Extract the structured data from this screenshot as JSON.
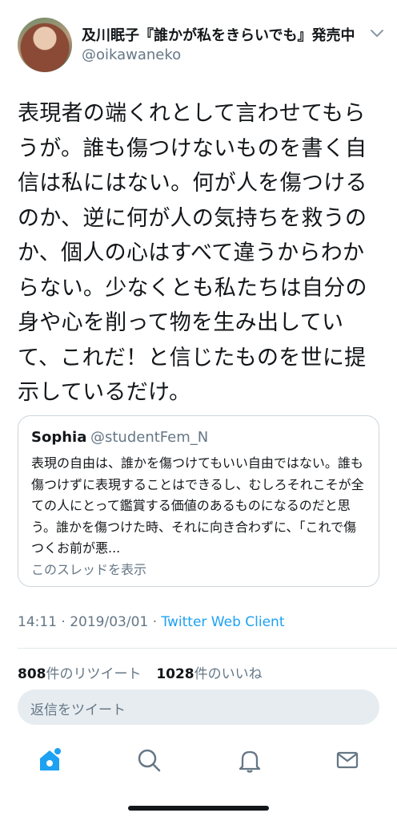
{
  "author": {
    "display_name": "及川眠子『誰かが私をきらいでも』発売中",
    "handle": "@oikawaneko"
  },
  "tweet": {
    "text": "表現者の端くれとして言わせてもらうが。誰も傷つけないものを書く自信は私にはない。何が人を傷つけるのか、逆に何が人の気持ちを救うのか、個人の心はすべて違うからわからない。少なくとも私たちは自分の身や心を削って物を生み出していて、これだ！と信じたものを世に提示しているだけ。"
  },
  "quoted_tweet": {
    "name": "Sophia",
    "handle": "@studentFem_N",
    "text": "表現の自由は、誰かを傷つけてもいい自由ではない。誰も傷つけずに表現することはできるし、むしろそれこそが全ての人にとって鑑賞する価値のあるものになるのだと思う。誰かを傷つけた時、それに向き合わずに、「これで傷つくお前が悪...",
    "thread_link": "このスレッドを表示"
  },
  "meta": {
    "time": "14:11",
    "date": "2019/03/01",
    "separator": "·",
    "client": "Twitter Web Client"
  },
  "stats": {
    "retweets_count": "808",
    "retweets_label": "件のリツイート",
    "likes_count": "1028",
    "likes_label": "件のいいね"
  },
  "reply": {
    "placeholder": "返信をツイート"
  },
  "tabbar": {
    "items": [
      "home-icon",
      "search-icon",
      "notifications-icon",
      "messages-icon"
    ],
    "active": "home-icon"
  },
  "colors": {
    "accent": "#1da1f2",
    "text": "#14171a",
    "secondary": "#657786",
    "border": "#ccd6dd",
    "reply_bg": "#e6ecf0"
  }
}
